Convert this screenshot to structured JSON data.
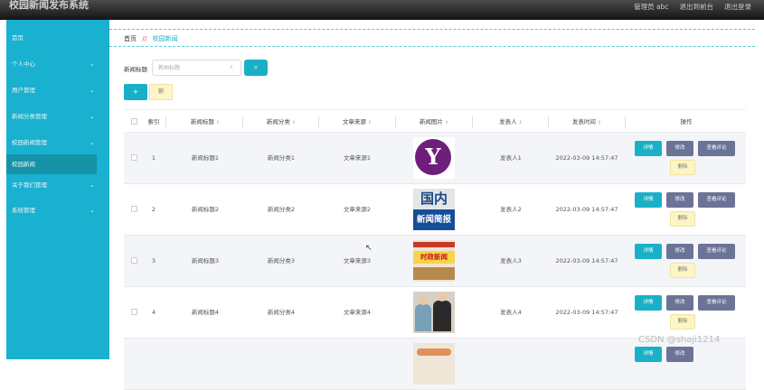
{
  "app": {
    "title": "校园新闻发布系统"
  },
  "topbar": {
    "links": [
      "管理员 abc",
      "退出到前台",
      "退出登录"
    ]
  },
  "sidebar": {
    "items": [
      {
        "label": "首页",
        "chevron": false,
        "active": false
      },
      {
        "label": "个人中心",
        "chevron": true,
        "active": false
      },
      {
        "label": "用户管理",
        "chevron": true,
        "active": false
      },
      {
        "label": "新闻分类管理",
        "chevron": true,
        "active": false
      },
      {
        "label": "校园新闻管理",
        "chevron": true,
        "active": false
      },
      {
        "label": "校园新闻",
        "chevron": false,
        "active": true
      },
      {
        "label": "关于我们管理",
        "chevron": true,
        "active": false
      },
      {
        "label": "系统管理",
        "chevron": true,
        "active": false
      }
    ]
  },
  "breadcrumb": {
    "home": "首页",
    "separator": "//",
    "current": "校园新闻"
  },
  "search": {
    "label": "新闻标题",
    "placeholder": "新闻标题",
    "button_icon": "search-icon"
  },
  "actions": {
    "add": "+",
    "delete": "删"
  },
  "table": {
    "columns": [
      "索引",
      "新闻标题",
      "新闻分类",
      "文章来源",
      "新闻图片",
      "发表人",
      "发表时间",
      "操作"
    ],
    "rows": [
      {
        "index": "1",
        "title": "新闻标题1",
        "category": "新闻分类1",
        "source": "文章来源1",
        "image": "yahoo",
        "author": "发表人1",
        "time": "2022-03-09 14:57:47"
      },
      {
        "index": "2",
        "title": "新闻标题2",
        "category": "新闻分类2",
        "source": "文章来源2",
        "image": "news",
        "author": "发表人2",
        "time": "2022-03-09 14:57:47"
      },
      {
        "index": "3",
        "title": "新闻标题3",
        "category": "新闻分类3",
        "source": "文章来源3",
        "image": "paper",
        "author": "发表人3",
        "time": "2022-03-09 14:57:47"
      },
      {
        "index": "4",
        "title": "新闻标题4",
        "category": "新闻分类4",
        "source": "文章来源4",
        "image": "photo",
        "author": "发表人4",
        "time": "2022-03-09 14:57:47"
      },
      {
        "index": "",
        "title": "",
        "category": "",
        "source": "",
        "image": "food",
        "author": "",
        "time": ""
      }
    ],
    "row_buttons": {
      "detail": "详情",
      "edit": "修改",
      "review": "查看评论",
      "delete": "删除"
    },
    "thumb_text": {
      "yahoo": "Y",
      "news_top": "国内",
      "news_bottom": "新闻简报",
      "paper": "时政新闻"
    }
  },
  "watermark": "CSDN @shaji1214"
}
